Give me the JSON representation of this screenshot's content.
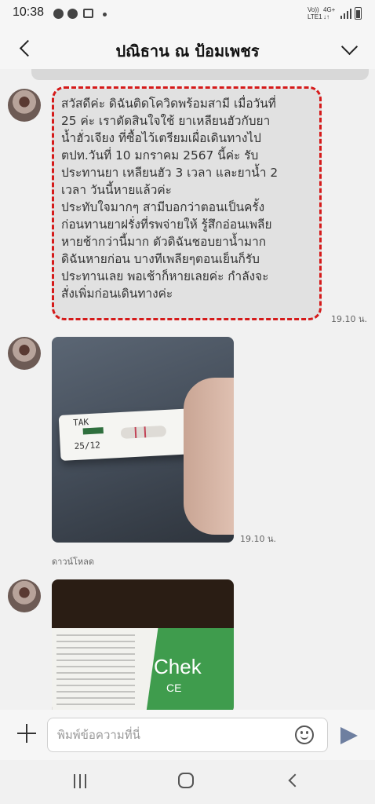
{
  "status_bar": {
    "time": "10:38",
    "network_left": "Vo)) LTE1",
    "network_right": "4G+ ↓↑"
  },
  "header": {
    "title": "ปณิธาน ณ ป้อมเพชร",
    "back_icon": "chevron-left-icon",
    "menu_icon": "chevron-down-icon"
  },
  "messages": [
    {
      "type": "text",
      "text": "สวัสดีค่ะ ดิฉันติดโควิดพร้อมสามี เมื่อวันที่\n25 ค่ะ เราตัดสินใจใช้ ยาเหลียนฮัวกับยา\nน้ำฮั่วเจียง ที่ซื้อไว้เตรียมเผื่อเดินทางไป\nตปท.วันที่ 10 มกราคม 2567 นี้ค่ะ รับ\nประทานยา เหลียนฮัว 3 เวลา และยาน้ำ 2\nเวลา วันนี้หายแล้วค่ะ\nประทับใจมากๆ สามีบอกว่าตอนเป็นครั้ง\nก่อนทานยาฝรั่งที่รพจ่ายให้ รู้สึกอ่อนเพลีย\nหายช้ากว่านี้มาก ตัวดิฉันชอบยาน้ำมาก\nดิฉันหายก่อน บางทีเพลียๆตอนเย็นก็รับ\nประทานเลย พอเช้าก็หายเลยค่ะ กำลังจะ\nสั่งเพิ่มก่อนเดินทางค่ะ",
      "time": "19.10 น."
    },
    {
      "type": "image",
      "photo_text": [
        "TAK",
        "25/12"
      ],
      "time": "19.10 น.",
      "download_label": "ดาวน์โหลด"
    },
    {
      "type": "image",
      "photo_text": [
        "Chek",
        "CE"
      ]
    }
  ],
  "input_bar": {
    "placeholder": "พิมพ์ข้อความที่นี่",
    "plus_icon": "plus-icon",
    "emoji_icon": "smiley-icon",
    "send_icon": "send-icon"
  },
  "colors": {
    "highlight": "#d51a1a",
    "bubble": "#e1e1e1",
    "send": "#6e7fa0"
  }
}
